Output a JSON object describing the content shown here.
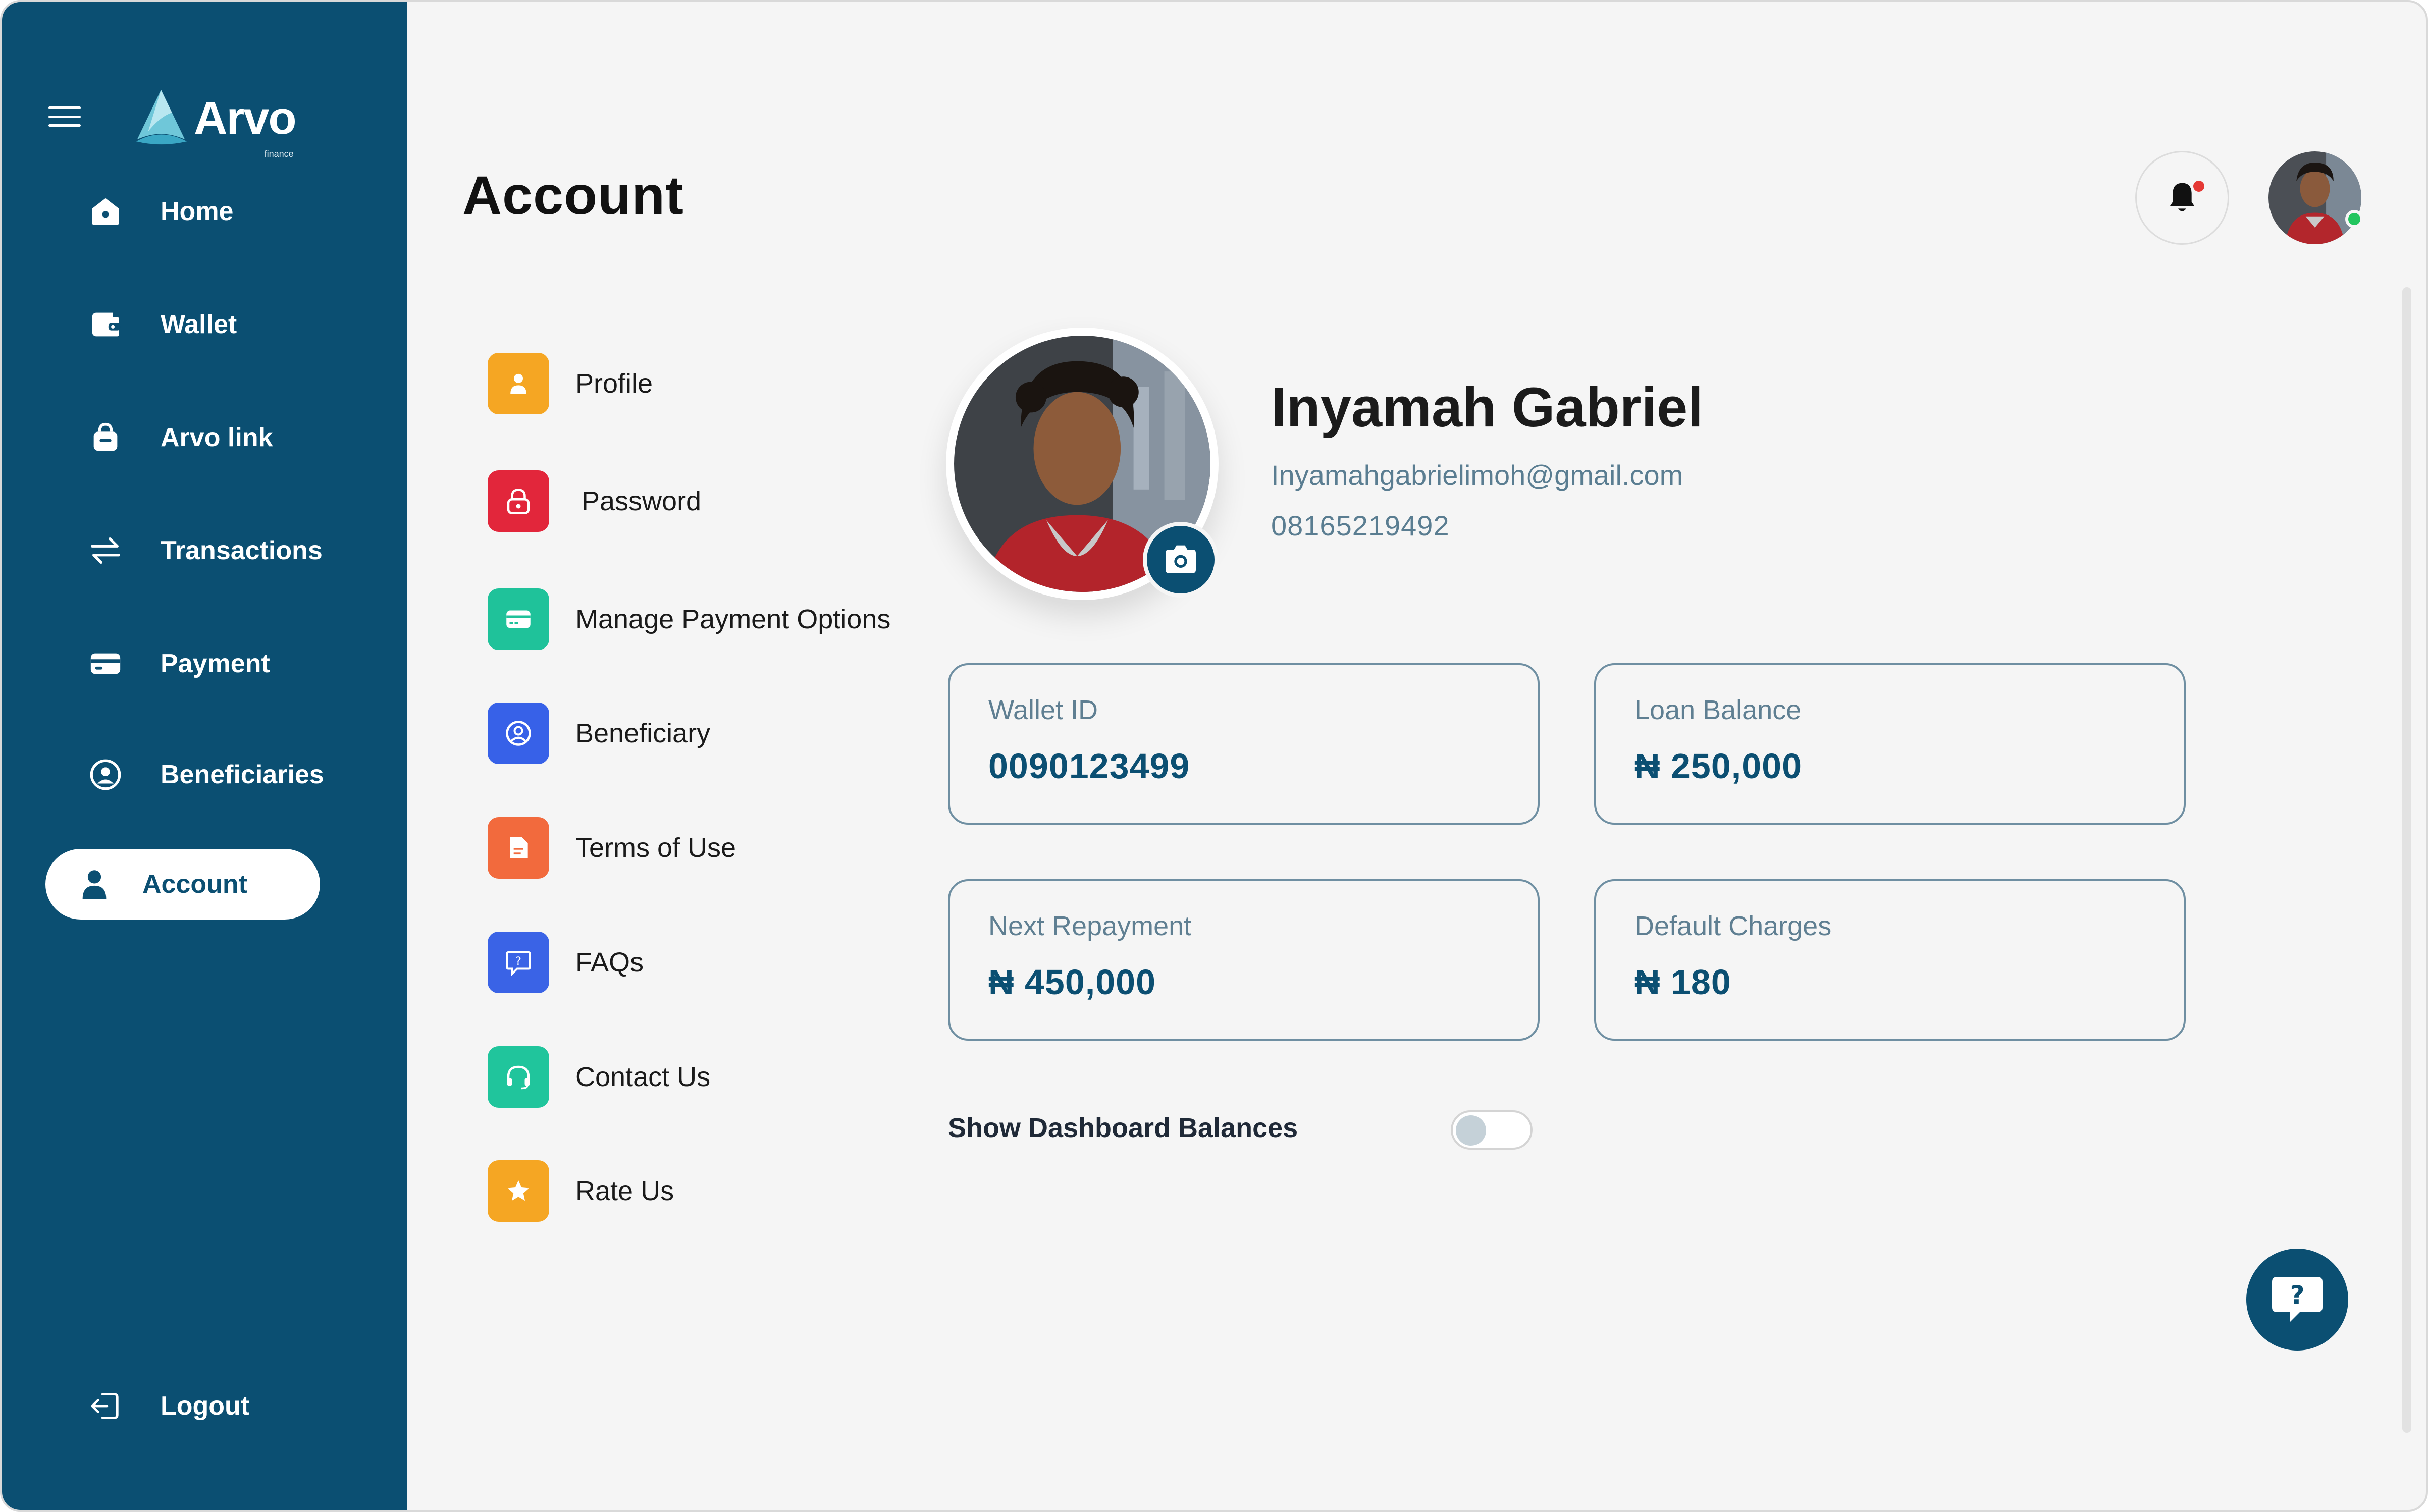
{
  "app": {
    "brand": "Arvo",
    "brand_sub": "finance"
  },
  "sidebar": {
    "items": [
      {
        "label": "Home",
        "icon": "home-icon"
      },
      {
        "label": "Wallet",
        "icon": "wallet-icon"
      },
      {
        "label": "Arvo link",
        "icon": "link-bag-icon"
      },
      {
        "label": "Transactions",
        "icon": "transfer-arrows-icon"
      },
      {
        "label": "Payment",
        "icon": "card-icon"
      },
      {
        "label": "Beneficiaries",
        "icon": "user-circle-icon"
      },
      {
        "label": "Account",
        "icon": "user-icon",
        "active": true
      }
    ],
    "logout_label": "Logout"
  },
  "header": {
    "title": "Account"
  },
  "account_menu": {
    "items": [
      {
        "label": "Profile",
        "icon": "user-icon",
        "color": "#f5a623"
      },
      {
        "label": "Password",
        "icon": "lock-icon",
        "color": "#e2263b"
      },
      {
        "label": "Manage Payment Options",
        "icon": "card-icon",
        "color": "#1fc29a"
      },
      {
        "label": "Beneficiary",
        "icon": "user-circle-icon",
        "color": "#3761e8"
      },
      {
        "label": "Terms of Use",
        "icon": "document-icon",
        "color": "#f26a3d"
      },
      {
        "label": "FAQs",
        "icon": "question-chat-icon",
        "color": "#3a63e6"
      },
      {
        "label": "Contact Us",
        "icon": "headset-icon",
        "color": "#20c59c"
      },
      {
        "label": "Rate Us",
        "icon": "star-icon",
        "color": "#f5a623"
      }
    ]
  },
  "profile": {
    "name": "Inyamah Gabriel",
    "email": "Inyamahgabrielimoh@gmail.com",
    "phone": "08165219492"
  },
  "cards": {
    "wallet_id": {
      "label": "Wallet ID",
      "value": "0090123499"
    },
    "loan_balance": {
      "label": "Loan Balance",
      "value": "₦ 250,000"
    },
    "next_repayment": {
      "label": "Next Repayment",
      "value": "₦ 450,000"
    },
    "default_charges": {
      "label": "Default Charges",
      "value": "₦ 180"
    }
  },
  "settings": {
    "show_balances_label": "Show Dashboard Balances",
    "show_balances_on": false
  },
  "colors": {
    "primary": "#0b4f72",
    "background": "#f5f5f5",
    "notification_dot": "#e53935",
    "online_dot": "#22c55e"
  }
}
